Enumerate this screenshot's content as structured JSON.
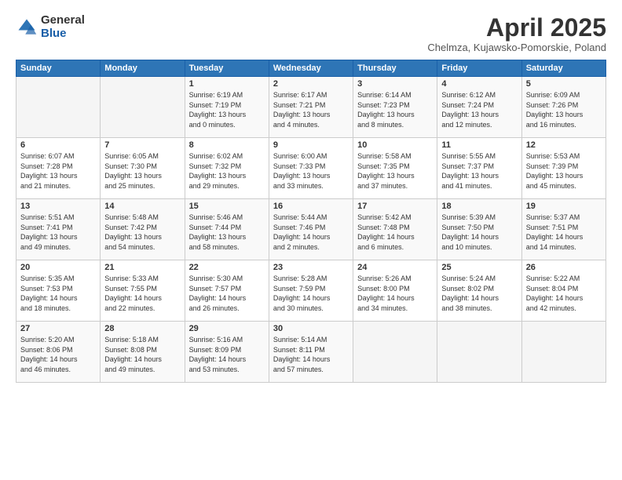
{
  "logo": {
    "general": "General",
    "blue": "Blue"
  },
  "title": "April 2025",
  "subtitle": "Chelmza, Kujawsko-Pomorskie, Poland",
  "weekdays": [
    "Sunday",
    "Monday",
    "Tuesday",
    "Wednesday",
    "Thursday",
    "Friday",
    "Saturday"
  ],
  "weeks": [
    [
      {
        "day": "",
        "info": ""
      },
      {
        "day": "",
        "info": ""
      },
      {
        "day": "1",
        "info": "Sunrise: 6:19 AM\nSunset: 7:19 PM\nDaylight: 13 hours\nand 0 minutes."
      },
      {
        "day": "2",
        "info": "Sunrise: 6:17 AM\nSunset: 7:21 PM\nDaylight: 13 hours\nand 4 minutes."
      },
      {
        "day": "3",
        "info": "Sunrise: 6:14 AM\nSunset: 7:23 PM\nDaylight: 13 hours\nand 8 minutes."
      },
      {
        "day": "4",
        "info": "Sunrise: 6:12 AM\nSunset: 7:24 PM\nDaylight: 13 hours\nand 12 minutes."
      },
      {
        "day": "5",
        "info": "Sunrise: 6:09 AM\nSunset: 7:26 PM\nDaylight: 13 hours\nand 16 minutes."
      }
    ],
    [
      {
        "day": "6",
        "info": "Sunrise: 6:07 AM\nSunset: 7:28 PM\nDaylight: 13 hours\nand 21 minutes."
      },
      {
        "day": "7",
        "info": "Sunrise: 6:05 AM\nSunset: 7:30 PM\nDaylight: 13 hours\nand 25 minutes."
      },
      {
        "day": "8",
        "info": "Sunrise: 6:02 AM\nSunset: 7:32 PM\nDaylight: 13 hours\nand 29 minutes."
      },
      {
        "day": "9",
        "info": "Sunrise: 6:00 AM\nSunset: 7:33 PM\nDaylight: 13 hours\nand 33 minutes."
      },
      {
        "day": "10",
        "info": "Sunrise: 5:58 AM\nSunset: 7:35 PM\nDaylight: 13 hours\nand 37 minutes."
      },
      {
        "day": "11",
        "info": "Sunrise: 5:55 AM\nSunset: 7:37 PM\nDaylight: 13 hours\nand 41 minutes."
      },
      {
        "day": "12",
        "info": "Sunrise: 5:53 AM\nSunset: 7:39 PM\nDaylight: 13 hours\nand 45 minutes."
      }
    ],
    [
      {
        "day": "13",
        "info": "Sunrise: 5:51 AM\nSunset: 7:41 PM\nDaylight: 13 hours\nand 49 minutes."
      },
      {
        "day": "14",
        "info": "Sunrise: 5:48 AM\nSunset: 7:42 PM\nDaylight: 13 hours\nand 54 minutes."
      },
      {
        "day": "15",
        "info": "Sunrise: 5:46 AM\nSunset: 7:44 PM\nDaylight: 13 hours\nand 58 minutes."
      },
      {
        "day": "16",
        "info": "Sunrise: 5:44 AM\nSunset: 7:46 PM\nDaylight: 14 hours\nand 2 minutes."
      },
      {
        "day": "17",
        "info": "Sunrise: 5:42 AM\nSunset: 7:48 PM\nDaylight: 14 hours\nand 6 minutes."
      },
      {
        "day": "18",
        "info": "Sunrise: 5:39 AM\nSunset: 7:50 PM\nDaylight: 14 hours\nand 10 minutes."
      },
      {
        "day": "19",
        "info": "Sunrise: 5:37 AM\nSunset: 7:51 PM\nDaylight: 14 hours\nand 14 minutes."
      }
    ],
    [
      {
        "day": "20",
        "info": "Sunrise: 5:35 AM\nSunset: 7:53 PM\nDaylight: 14 hours\nand 18 minutes."
      },
      {
        "day": "21",
        "info": "Sunrise: 5:33 AM\nSunset: 7:55 PM\nDaylight: 14 hours\nand 22 minutes."
      },
      {
        "day": "22",
        "info": "Sunrise: 5:30 AM\nSunset: 7:57 PM\nDaylight: 14 hours\nand 26 minutes."
      },
      {
        "day": "23",
        "info": "Sunrise: 5:28 AM\nSunset: 7:59 PM\nDaylight: 14 hours\nand 30 minutes."
      },
      {
        "day": "24",
        "info": "Sunrise: 5:26 AM\nSunset: 8:00 PM\nDaylight: 14 hours\nand 34 minutes."
      },
      {
        "day": "25",
        "info": "Sunrise: 5:24 AM\nSunset: 8:02 PM\nDaylight: 14 hours\nand 38 minutes."
      },
      {
        "day": "26",
        "info": "Sunrise: 5:22 AM\nSunset: 8:04 PM\nDaylight: 14 hours\nand 42 minutes."
      }
    ],
    [
      {
        "day": "27",
        "info": "Sunrise: 5:20 AM\nSunset: 8:06 PM\nDaylight: 14 hours\nand 46 minutes."
      },
      {
        "day": "28",
        "info": "Sunrise: 5:18 AM\nSunset: 8:08 PM\nDaylight: 14 hours\nand 49 minutes."
      },
      {
        "day": "29",
        "info": "Sunrise: 5:16 AM\nSunset: 8:09 PM\nDaylight: 14 hours\nand 53 minutes."
      },
      {
        "day": "30",
        "info": "Sunrise: 5:14 AM\nSunset: 8:11 PM\nDaylight: 14 hours\nand 57 minutes."
      },
      {
        "day": "",
        "info": ""
      },
      {
        "day": "",
        "info": ""
      },
      {
        "day": "",
        "info": ""
      }
    ]
  ]
}
